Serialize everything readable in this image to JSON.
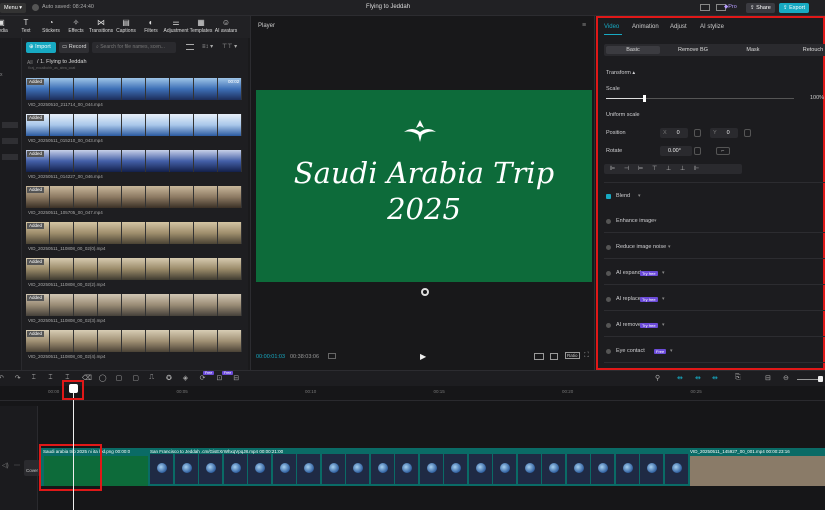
{
  "topbar": {
    "menu": "Menu",
    "autosave": "Auto saved: 08:24:40",
    "title": "Flying to Jeddah",
    "pro": "Pro",
    "share": "Share",
    "export": "Export"
  },
  "toolbar": {
    "items": [
      {
        "label": "Media",
        "icon": "media-icon"
      },
      {
        "label": "Text",
        "icon": "text-icon"
      },
      {
        "label": "Stickers",
        "icon": "sticker-icon"
      },
      {
        "label": "Effects",
        "icon": "effects-icon"
      },
      {
        "label": "Transitions",
        "icon": "transitions-icon"
      },
      {
        "label": "Captions",
        "icon": "captions-icon"
      },
      {
        "label": "Filters",
        "icon": "filters-icon"
      },
      {
        "label": "Adjustment",
        "icon": "adjustment-icon"
      },
      {
        "label": "Templates",
        "icon": "templates-icon"
      },
      {
        "label": "AI avatars",
        "icon": "ai-avatars-icon"
      }
    ]
  },
  "media": {
    "import": "Import",
    "record": "Record",
    "search_placeholder": "Search for file names, scen...",
    "breadcrumb_all": "All",
    "folder": "1. Flying to Jeddah",
    "folder_sub": "Kraj_excalbohb_as_abra_coat",
    "added": "Added",
    "first_duration": "00:02",
    "files": [
      "VID_20250510_211714_00_044.mp4",
      "VID_20250511_015210_00_043.mp4",
      "VID_20250511_014227_00_046.mp4",
      "VID_20250511_105705_00_047.mp4",
      "VID_20250511_110808_00_02(0).mp4",
      "VID_20250511_110808_00_02(2).mp4",
      "VID_20250511_110808_00_02(3).mp4",
      "VID_20250511_110808_00_02(4).mp4"
    ]
  },
  "player": {
    "label": "Player",
    "title_line1": "Saudi Arabia Trip",
    "title_line2": "2025",
    "current_time": "00:00:01:03",
    "total_time": "00:38:03:06",
    "ratio": "Ratio"
  },
  "properties": {
    "tabs": [
      "Video",
      "Animation",
      "Adjust",
      "AI stylize"
    ],
    "subtabs": [
      "Basic",
      "Remove BG",
      "Mask",
      "Retouch"
    ],
    "transform": "Transform",
    "scale": "Scale",
    "scale_value": "100%",
    "scale_level": 0.2,
    "uniform_scale": "Uniform scale",
    "position": "Position",
    "pos_x": "0",
    "pos_y": "0",
    "rotate": "Rotate",
    "rotate_value": "0.00°",
    "blend": "Blend",
    "enhance": "Enhance image",
    "reduce": "Reduce image noise",
    "ai_expand": "AI expand",
    "ai_replace": "AI replace",
    "ai_remove": "AI remove",
    "eye_contact": "Eye contact",
    "try_free": "Try free",
    "free": "Free"
  },
  "timeline": {
    "ticks": [
      "00:00",
      "00:05",
      "00:10",
      "00:15",
      "00:20",
      "00:25"
    ],
    "clip1": "Saudi arabia trip 2025 ni ita lpd.png",
    "clip1_dur": "00:00:0",
    "clip2": "San Francisco to Jeddah .cm/GisEXrWhxqVpqJ8.mp4",
    "clip2_dur": "00:00:21:00",
    "clip3": "VID_20250511_145927_00_001.mp4",
    "clip3_dur": "00:00:23:16",
    "cover": "Cover"
  }
}
